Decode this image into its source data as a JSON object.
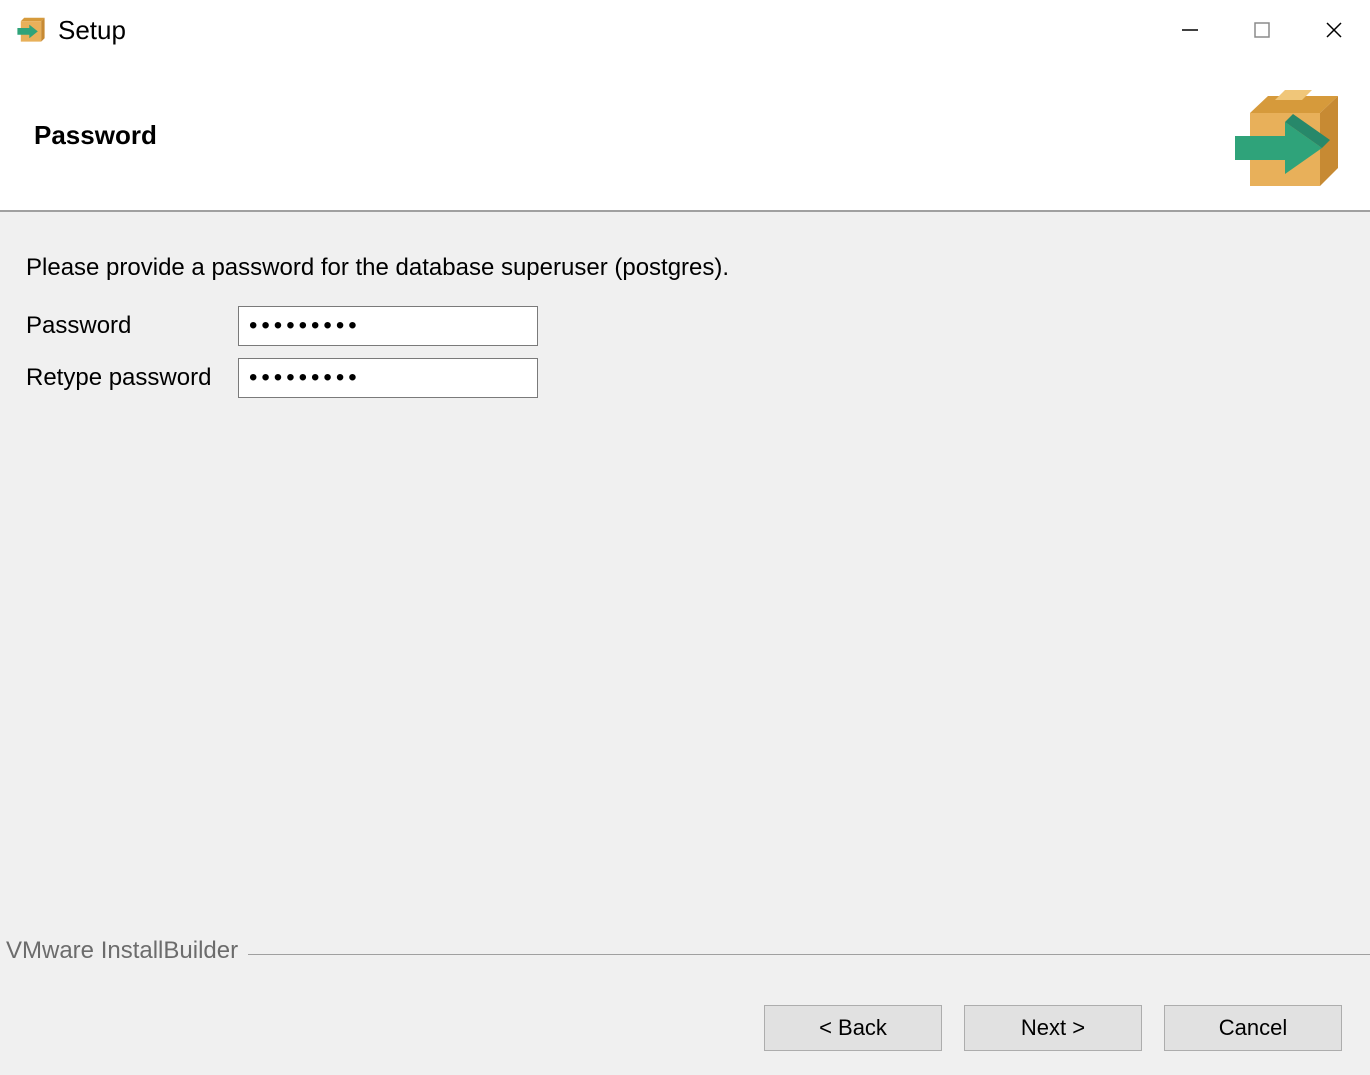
{
  "titlebar": {
    "title": "Setup"
  },
  "header": {
    "title": "Password"
  },
  "content": {
    "instruction": "Please provide a password for the database superuser (postgres).",
    "password_label": "Password",
    "retype_label": "Retype password",
    "password_value": "•••••••••",
    "retype_value": "•••••••••"
  },
  "footer": {
    "brand": "VMware InstallBuilder",
    "back": "< Back",
    "next": "Next >",
    "cancel": "Cancel"
  }
}
